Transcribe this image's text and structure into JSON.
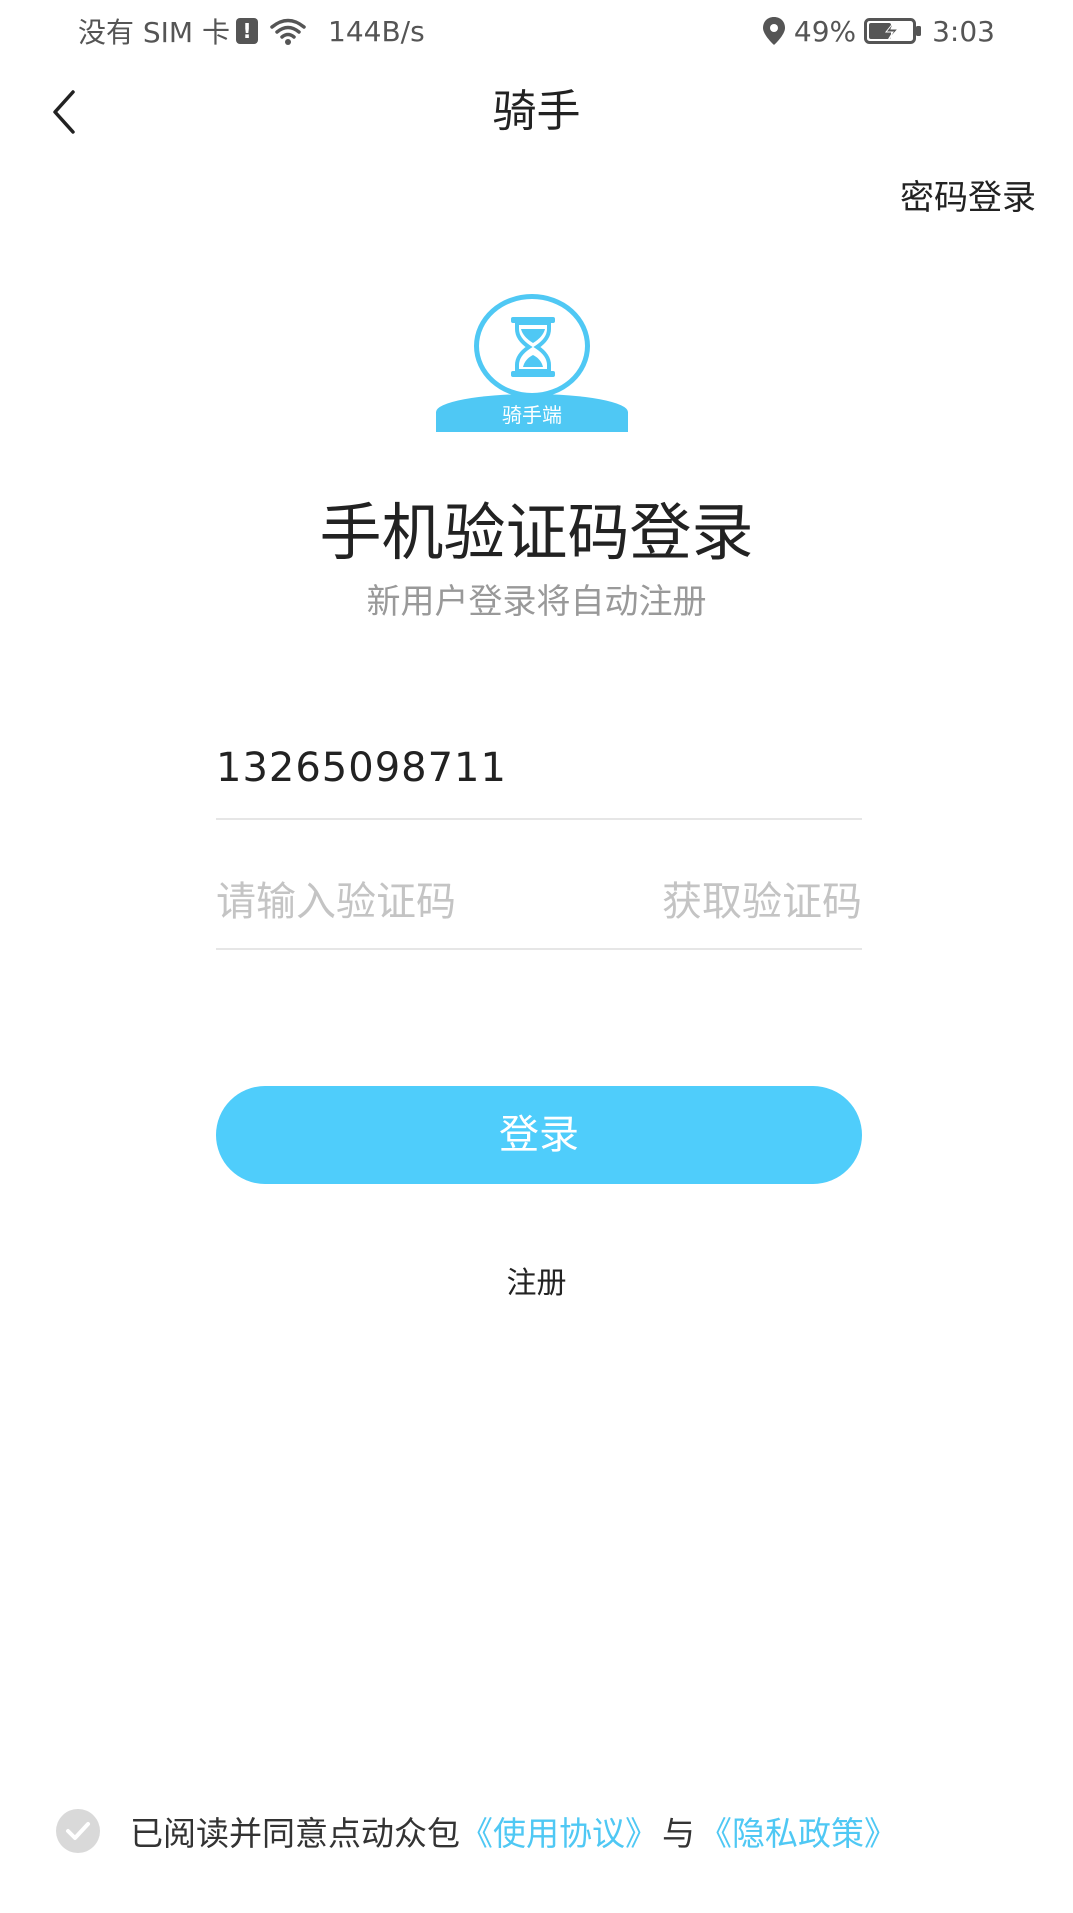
{
  "status_bar": {
    "carrier": "没有 SIM 卡",
    "net_speed": "144B/s",
    "battery": "49%",
    "time": "3:03"
  },
  "header": {
    "title": "骑手",
    "password_login": "密码登录"
  },
  "logo": {
    "banner_text": "骑手端"
  },
  "main": {
    "heading": "手机验证码登录",
    "subheading": "新用户登录将自动注册",
    "phone_value": "13265098711",
    "code_placeholder": "请输入验证码",
    "get_code_label": "获取验证码",
    "login_label": "登录",
    "register_label": "注册"
  },
  "agreement": {
    "text": "已阅读并同意点动众包",
    "terms_link": "《使用协议》",
    "and": "与",
    "privacy_link": "《隐私政策》"
  },
  "colors": {
    "accent": "#4fcdfb",
    "link": "#4fc8f4",
    "placeholder": "#c4c4c4"
  }
}
